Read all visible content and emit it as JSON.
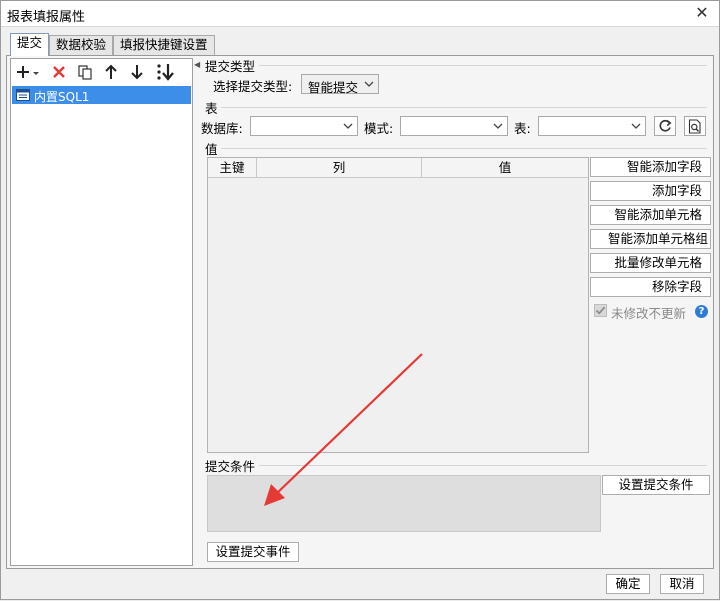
{
  "window": {
    "title": "报表填报属性"
  },
  "tabs": [
    {
      "label": "提交"
    },
    {
      "label": "数据校验"
    },
    {
      "label": "填报快捷键设置"
    }
  ],
  "tree": {
    "items": [
      {
        "label": "内置SQL1"
      }
    ]
  },
  "submit_type": {
    "section": "提交类型",
    "label": "选择提交类型:",
    "value": "智能提交"
  },
  "table_section": {
    "section": "表",
    "database_label": "数据库:",
    "database_value": "",
    "schema_label": "模式:",
    "schema_value": "",
    "table_label": "表:",
    "table_value": ""
  },
  "value_section": {
    "section": "值",
    "columns": [
      "主键",
      "列",
      "值"
    ],
    "buttons": [
      "智能添加字段",
      "添加字段",
      "智能添加单元格",
      "智能添加单元格组",
      "批量修改单元格",
      "移除字段"
    ],
    "no_update_label": "未修改不更新"
  },
  "condition_section": {
    "section": "提交条件",
    "set_button": "设置提交条件"
  },
  "event_button": "设置提交事件",
  "footer": {
    "ok": "确定",
    "cancel": "取消"
  },
  "colors": {
    "accent": "#3d8ee8",
    "annotation": "#e53935"
  }
}
